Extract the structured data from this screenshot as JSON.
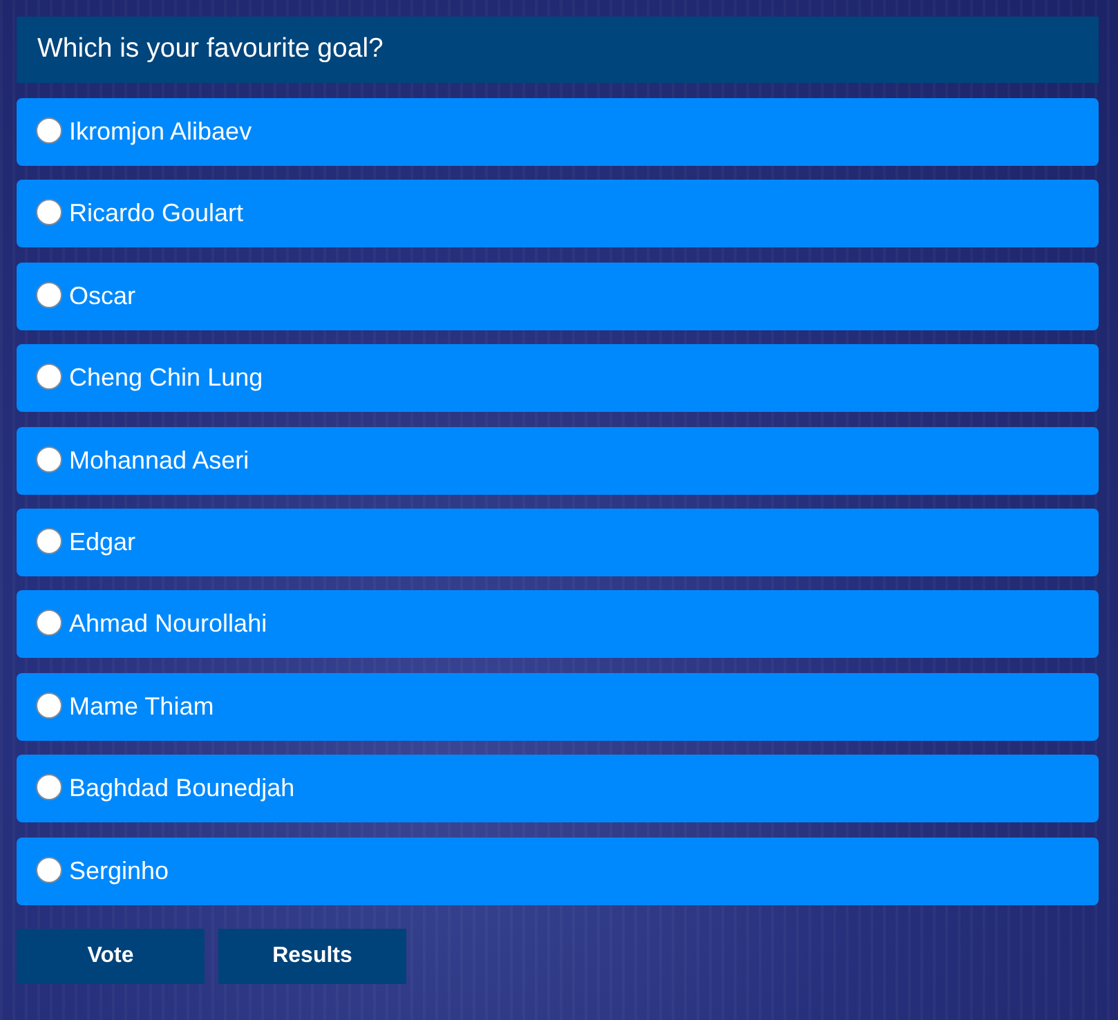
{
  "poll": {
    "question": "Which is your favourite goal?",
    "options": [
      {
        "label": "Ikromjon Alibaev",
        "selected": false
      },
      {
        "label": "Ricardo Goulart",
        "selected": false
      },
      {
        "label": "Oscar",
        "selected": false
      },
      {
        "label": "Cheng Chin Lung",
        "selected": false
      },
      {
        "label": "Mohannad Aseri",
        "selected": false
      },
      {
        "label": "Edgar",
        "selected": false
      },
      {
        "label": "Ahmad Nourollahi",
        "selected": false
      },
      {
        "label": "Mame Thiam",
        "selected": false
      },
      {
        "label": "Baghdad Bounedjah",
        "selected": false
      },
      {
        "label": "Serginho",
        "selected": false
      }
    ]
  },
  "buttons": [
    {
      "label": "Vote"
    },
    {
      "label": "Results"
    }
  ]
}
